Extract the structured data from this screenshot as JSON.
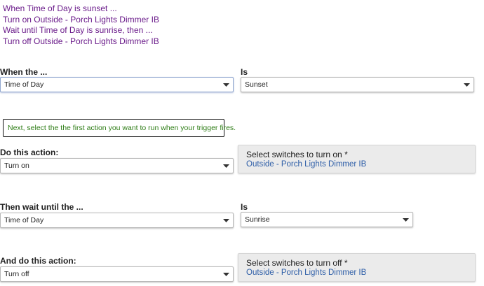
{
  "summary": [
    "When Time of Day is sunset ...",
    "Turn on Outside - Porch Lights Dimmer IB",
    "Wait until Time of Day is sunrise, then ...",
    "Turn off Outside - Porch Lights Dimmer IB"
  ],
  "trigger": {
    "when_label": "When the ...",
    "when_value": "Time of Day",
    "is_label": "Is",
    "is_value": "Sunset"
  },
  "hint": "Next, select the the first action you want to run when your trigger fires.",
  "action1": {
    "label": "Do this action:",
    "value": "Turn on",
    "panel_title": "Select switches to turn on *",
    "panel_value": "Outside - Porch Lights Dimmer IB"
  },
  "wait": {
    "label": "Then wait until the ...",
    "value": "Time of Day",
    "is_label": "Is",
    "is_value": "Sunrise"
  },
  "action2": {
    "label": "And do this action:",
    "value": "Turn off",
    "panel_title": "Select switches to turn off *",
    "panel_value": "Outside - Porch Lights Dimmer IB"
  },
  "colors": {
    "summary_text": "#6a1b8a",
    "hint_text": "#2e7d16",
    "link_text": "#2f5fa8",
    "panel_bg": "#ebebeb"
  }
}
